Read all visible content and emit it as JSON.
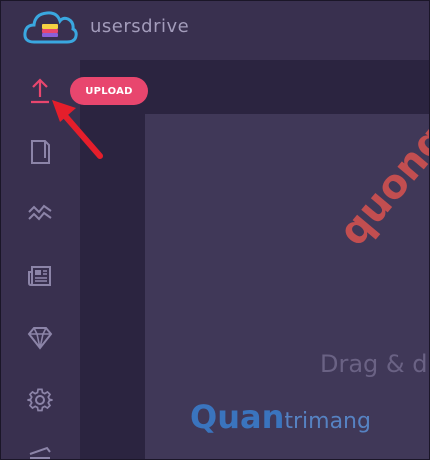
{
  "app": {
    "brand": "usersdrive"
  },
  "toolbar": {
    "upload_label": "UPLOAD"
  },
  "main": {
    "drop_text": "Drag & d"
  },
  "watermark": {
    "top": "quongtin.top",
    "bottom_bold": "Quan",
    "bottom_rest": "trimang"
  },
  "colors": {
    "accent": "#e8466e",
    "sidebar_bg": "#39304f",
    "content_bg": "#2b2440",
    "panel_bg": "#403858",
    "icon": "#8c84a8",
    "arrow": "#e51e2b"
  },
  "sidebar": {
    "items": [
      {
        "icon": "upload-icon",
        "active": true
      },
      {
        "icon": "file-icon",
        "active": false
      },
      {
        "icon": "chart-icon",
        "active": false
      },
      {
        "icon": "newspaper-icon",
        "active": false
      },
      {
        "icon": "diamond-icon",
        "active": false
      },
      {
        "icon": "gear-icon",
        "active": false
      },
      {
        "icon": "folder-icon",
        "active": false
      }
    ]
  }
}
